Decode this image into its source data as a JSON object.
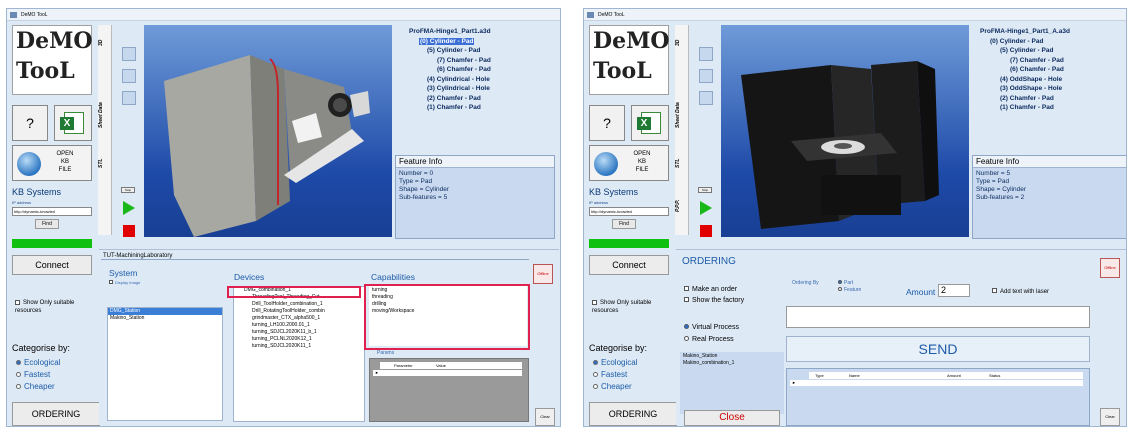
{
  "left": {
    "window_title": "DeMO TooL",
    "logo": {
      "line1": "DeMO",
      "line2": "TooL"
    },
    "help_button": "?",
    "open_button": "OPEN\nKB\nFILE",
    "kb_systems": "KB Systems",
    "ip_label": "IP address",
    "url_value": "http://dynamic-knowled",
    "find_button": "Find",
    "connect_button": "Connect",
    "show_only": "Show Only suitable resources",
    "categorise_by": "Categorise by:",
    "categories": [
      "Ecological",
      "Fastest",
      "Cheaper"
    ],
    "ordering_button": "ORDERING",
    "vtabs": [
      "3D",
      "Sheet Data",
      "STL"
    ],
    "stop_label": "Stop",
    "tree_title": "ProFMA-Hinge1_Part1.a3d",
    "tree_items": [
      "(0) Cylinder - Pad",
      "(5) Cylinder - Pad",
      "(7) Chamfer - Pad",
      "(6) Chamfer - Pad",
      "(4) Cylindrical - Hole",
      "(3) Cylindrical - Hole",
      "(2) Chamfer - Pad",
      "(1) Chamfer - Pad"
    ],
    "feature_info": {
      "title": "Feature Info",
      "lines": [
        "Number = 0",
        "Type = Pad",
        "Shape = Cylinder",
        "Sub-features = 5"
      ]
    },
    "path": "TUT-MachiningLaboratory",
    "system_label": "System",
    "display_image": "Display Image",
    "system_items": [
      "DMG_Station",
      "Makino_Station"
    ],
    "devices_label": "Devices",
    "device_items": [
      "DMG_combination_1",
      "ThreadingTool_Threading_Cut",
      "Drill_ToolHolder_combination_1",
      "Drill_RotatingToolHolder_combin",
      "grindmaster_CTX_alpha500_1",
      "turning_LH100.2000.01_1",
      "turning_SDJCL2020K11_b_1",
      "turning_PCLNL2020K12_1",
      "turning_SDJCL2020K11_1"
    ],
    "capabilities_label": "Capabilities",
    "capability_items": [
      "turning",
      "threading",
      "drilling",
      "moving/Workspace"
    ],
    "params_label": "Params",
    "param_headers": [
      "Parameter",
      "Value"
    ],
    "offline_label": "Offline",
    "clear_label": "Clear"
  },
  "right": {
    "window_title": "DeMO TooL",
    "logo": {
      "line1": "DeMO",
      "line2": "TooL"
    },
    "help_button": "?",
    "open_button": "OPEN\nKB\nFILE",
    "kb_systems": "KB Systems",
    "ip_label": "IP address",
    "url_value": "http://dynamic-knowled",
    "find_button": "Find",
    "connect_button": "Connect",
    "show_only": "Show Only suitable resources",
    "categorise_by": "Categorise by:",
    "categories": [
      "Ecological",
      "Fastest",
      "Cheaper"
    ],
    "ordering_button": "ORDERING",
    "vtabs": [
      "3D",
      "Sheet Data",
      "STL",
      "P.P.P."
    ],
    "stop_label": "Stop",
    "tree_title": "ProFMA-Hinge1_Part1_A.a3d",
    "tree_items": [
      "(0) Cylinder - Pad",
      "(5) Cylinder - Pad",
      "(7) Chamfer - Pad",
      "(6) Chamfer - Pad",
      "(4) OddShape - Hole",
      "(3) OddShape - Hole",
      "(2) Chamfer - Pad",
      "(1) Chamfer - Pad"
    ],
    "feature_info": {
      "title": "Feature Info",
      "lines": [
        "Number = 5",
        "Type = Pad",
        "Shape = Cylinder",
        "Sub-features = 2"
      ]
    },
    "ordering_title": "ORDERING",
    "make_order": "Make an order",
    "show_factory": "Show the factory",
    "virtual_process": "Virtual Process",
    "real_process": "Real Process",
    "ordering_by": "Ordering By",
    "ordering_options": [
      "Part",
      "Feature"
    ],
    "amount_label": "Amount",
    "amount_value": "2",
    "add_text_laser": "Add text with laser",
    "station_items": [
      "Makino_Station",
      "Makino_combination_1"
    ],
    "send_button": "SEND",
    "close_button": "Close",
    "table_headers": [
      "Type",
      "Name",
      "Amount",
      "Status"
    ],
    "offline_label": "Offline",
    "clear_label": "Clear"
  }
}
